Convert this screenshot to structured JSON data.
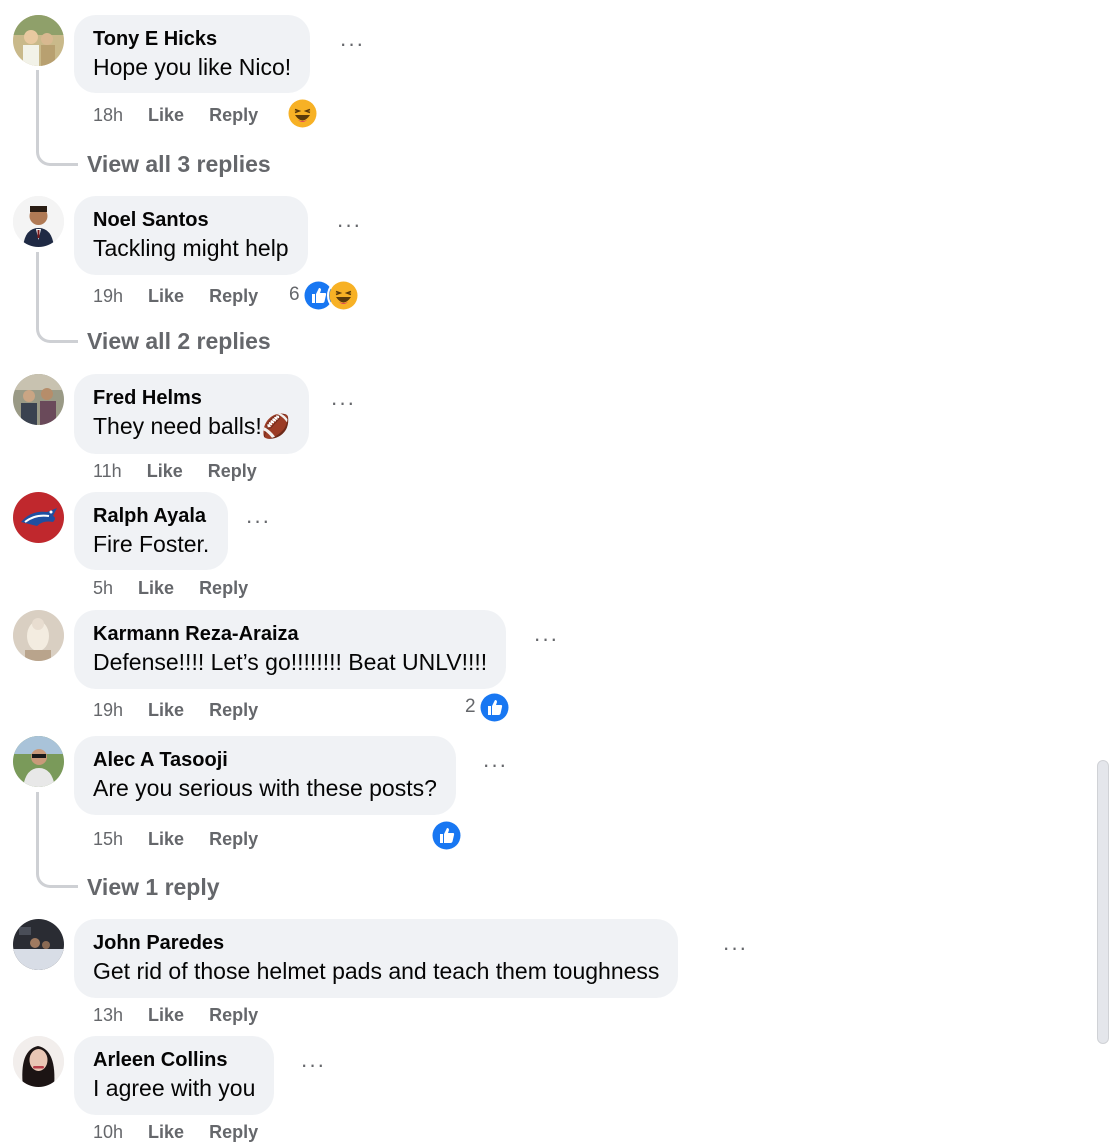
{
  "comments": [
    {
      "author": "Tony E Hicks",
      "text": "Hope you like Nico!",
      "time": "18h",
      "like": "Like",
      "reply": "Reply",
      "reactions": [
        "haha"
      ],
      "reaction_count": "",
      "view_replies": "View all 3 replies"
    },
    {
      "author": "Noel Santos",
      "text": "Tackling might help",
      "time": "19h",
      "like": "Like",
      "reply": "Reply",
      "reactions": [
        "like",
        "haha"
      ],
      "reaction_count": "6",
      "view_replies": "View all 2 replies"
    },
    {
      "author": "Fred Helms",
      "text": "They need balls!🏈",
      "time": "11h",
      "like": "Like",
      "reply": "Reply",
      "reactions": [],
      "reaction_count": ""
    },
    {
      "author": "Ralph Ayala",
      "text": "Fire Foster.",
      "time": "5h",
      "like": "Like",
      "reply": "Reply",
      "reactions": [],
      "reaction_count": ""
    },
    {
      "author": "Karmann Reza-Araiza",
      "text": "Defense!!!! Let’s go!!!!!!!! Beat UNLV!!!!",
      "time": "19h",
      "like": "Like",
      "reply": "Reply",
      "reactions": [
        "like"
      ],
      "reaction_count": "2"
    },
    {
      "author": "Alec A Tasooji",
      "text": "Are you serious with these posts?",
      "time": "15h",
      "like": "Like",
      "reply": "Reply",
      "reactions": [
        "like"
      ],
      "reaction_count": "",
      "view_replies": "View 1 reply"
    },
    {
      "author": "John Paredes",
      "text": "Get rid of those helmet pads and teach them toughness",
      "time": "13h",
      "like": "Like",
      "reply": "Reply",
      "reactions": [],
      "reaction_count": ""
    },
    {
      "author": "Arleen Collins",
      "text": "I agree with you",
      "time": "10h",
      "like": "Like",
      "reply": "Reply",
      "reactions": [],
      "reaction_count": ""
    }
  ],
  "more_label": "···",
  "colors": {
    "bubble": "#f0f2f5",
    "secondary_text": "#65676b",
    "like_blue": "#1877f2",
    "haha_yellow": "#f7b125",
    "thread_line": "#ced0d4"
  }
}
